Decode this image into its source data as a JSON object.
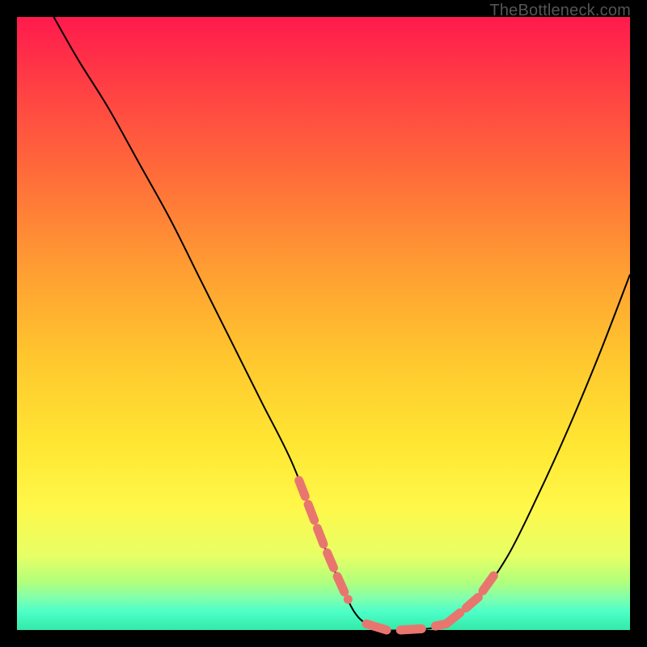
{
  "watermark": "TheBottleneck.com",
  "colors": {
    "segment": "#e8766f",
    "line": "#000000",
    "gradient_top": "#ff1a4d",
    "gradient_bottom": "#33e9a8"
  },
  "chart_data": {
    "type": "line",
    "title": "",
    "xlabel": "",
    "ylabel": "",
    "xlim": [
      0,
      100
    ],
    "ylim": [
      0,
      100
    ],
    "series": [
      {
        "name": "curve",
        "x": [
          6,
          10,
          15,
          20,
          25,
          30,
          35,
          40,
          45,
          50,
          53,
          55,
          57,
          60,
          63,
          65,
          70,
          75,
          80,
          85,
          90,
          95,
          100
        ],
        "y": [
          100,
          93,
          85,
          76,
          67,
          57,
          47,
          37,
          27,
          14,
          7,
          3,
          1,
          0,
          0,
          0,
          1,
          5,
          12,
          22,
          33,
          45,
          58
        ]
      }
    ],
    "highlighted_segments": {
      "description": "thick salmon dashes along the curve near the minimum",
      "left_arm_x_range": [
        46,
        54
      ],
      "floor_x_range": [
        57,
        70
      ],
      "right_arm_x_range": [
        70,
        78
      ]
    }
  }
}
